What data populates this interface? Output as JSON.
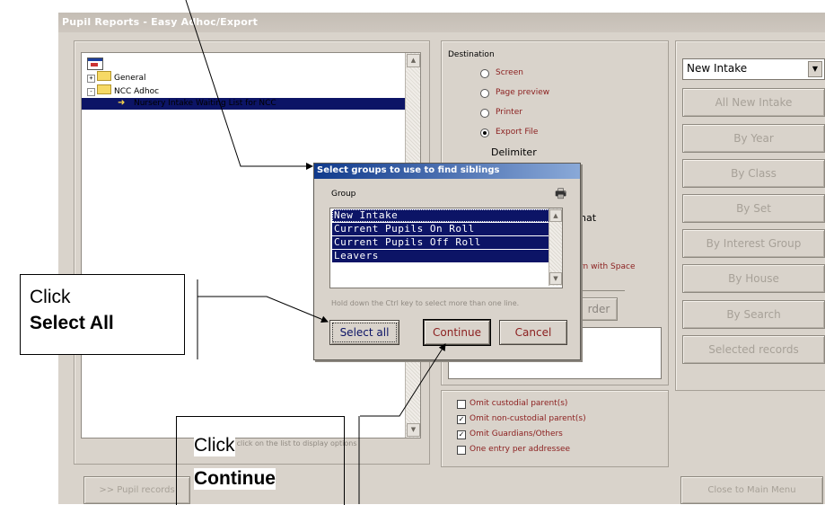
{
  "window": {
    "title": "Pupil Reports - Easy Adhoc/Export"
  },
  "tree": {
    "items": [
      {
        "label": "General",
        "expander": "+"
      },
      {
        "label": "NCC Adhoc",
        "expander": "-"
      },
      {
        "label": "Nursery Intake Waiting List for NCC"
      }
    ],
    "hint": "Right click on the list to display options"
  },
  "destination": {
    "heading": "Destination",
    "options": [
      {
        "label": "Screen",
        "checked": false
      },
      {
        "label": "Page preview",
        "checked": false
      },
      {
        "label": "Printer",
        "checked": false
      },
      {
        "label": "Export File",
        "checked": true
      }
    ],
    "delimiter_label": "Delimiter",
    "format_fragment": "nat",
    "replace_fragment": "rn with Space",
    "order_button_fragment": "rder"
  },
  "right_panel": {
    "select_value": "New Intake",
    "buttons": [
      "All New Intake",
      "By Year",
      "By Class",
      "By Set",
      "By Interest Group",
      "By House",
      "By Search",
      "Selected records"
    ]
  },
  "checkboxes": [
    {
      "label": "Omit custodial parent(s)",
      "checked": false
    },
    {
      "label": "Omit non-custodial parent(s)",
      "checked": true
    },
    {
      "label": "Omit Guardians/Others",
      "checked": true
    },
    {
      "label": "One entry per addressee",
      "checked": false
    }
  ],
  "bottom": {
    "pupil_records": ">> Pupil records",
    "close": "Close to Main Menu"
  },
  "dialog": {
    "title": "Select groups to use to find siblings",
    "group_label": "Group",
    "groups": [
      "New Intake",
      "Current Pupils On Roll",
      "Current Pupils Off Roll",
      "Leavers"
    ],
    "hint": "Hold down the Ctrl key to select more than one line.",
    "select_all": "Select all",
    "continue": "Continue",
    "cancel": "Cancel"
  },
  "callouts": {
    "select_all_line1": "Click",
    "select_all_line2": "Select All",
    "continue_line1": "Click",
    "continue_line2": "Continue"
  },
  "colors": {
    "selection": "#0c1466",
    "label_red": "#8b1e1e",
    "window": "#d9d3cb"
  }
}
